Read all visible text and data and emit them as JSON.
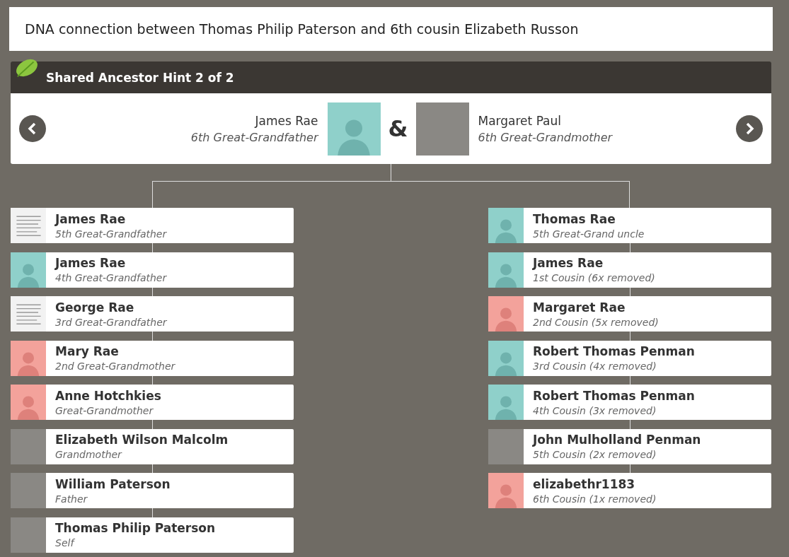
{
  "title": "DNA connection between Thomas Philip Paterson and 6th cousin Elizabeth Russon",
  "hint": {
    "title": "Shared Ancestor Hint 2 of 2"
  },
  "couple": {
    "left": {
      "name": "James Rae",
      "relation": "6th Great-Grandfather",
      "kind": "male"
    },
    "joiner": "&",
    "right": {
      "name": "Margaret Paul",
      "relation": "6th Great-Grandmother",
      "kind": "photo"
    }
  },
  "lines": {
    "left": [
      {
        "name": "James Rae",
        "relation": "5th Great-Grandfather",
        "kind": "document"
      },
      {
        "name": "James Rae",
        "relation": "4th Great-Grandfather",
        "kind": "male"
      },
      {
        "name": "George Rae",
        "relation": "3rd Great-Grandfather",
        "kind": "document"
      },
      {
        "name": "Mary Rae",
        "relation": "2nd Great-Grandmother",
        "kind": "female"
      },
      {
        "name": "Anne Hotchkies",
        "relation": "Great-Grandmother",
        "kind": "female"
      },
      {
        "name": "Elizabeth Wilson Malcolm",
        "relation": "Grandmother",
        "kind": "photo"
      },
      {
        "name": "William Paterson",
        "relation": "Father",
        "kind": "photo"
      },
      {
        "name": "Thomas Philip Paterson",
        "relation": "Self",
        "kind": "photo"
      }
    ],
    "right": [
      {
        "name": "Thomas Rae",
        "relation": "5th Great-Grand uncle",
        "kind": "male"
      },
      {
        "name": "James Rae",
        "relation": "1st Cousin (6x removed)",
        "kind": "male"
      },
      {
        "name": "Margaret Rae",
        "relation": "2nd Cousin (5x removed)",
        "kind": "female"
      },
      {
        "name": "Robert Thomas Penman",
        "relation": "3rd Cousin (4x removed)",
        "kind": "male"
      },
      {
        "name": "Robert Thomas Penman",
        "relation": "4th Cousin (3x removed)",
        "kind": "male"
      },
      {
        "name": "John Mulholland Penman",
        "relation": "5th Cousin (2x removed)",
        "kind": "photo"
      },
      {
        "name": "elizabethr1183",
        "relation": "6th Cousin (1x removed)",
        "kind": "female"
      }
    ]
  }
}
